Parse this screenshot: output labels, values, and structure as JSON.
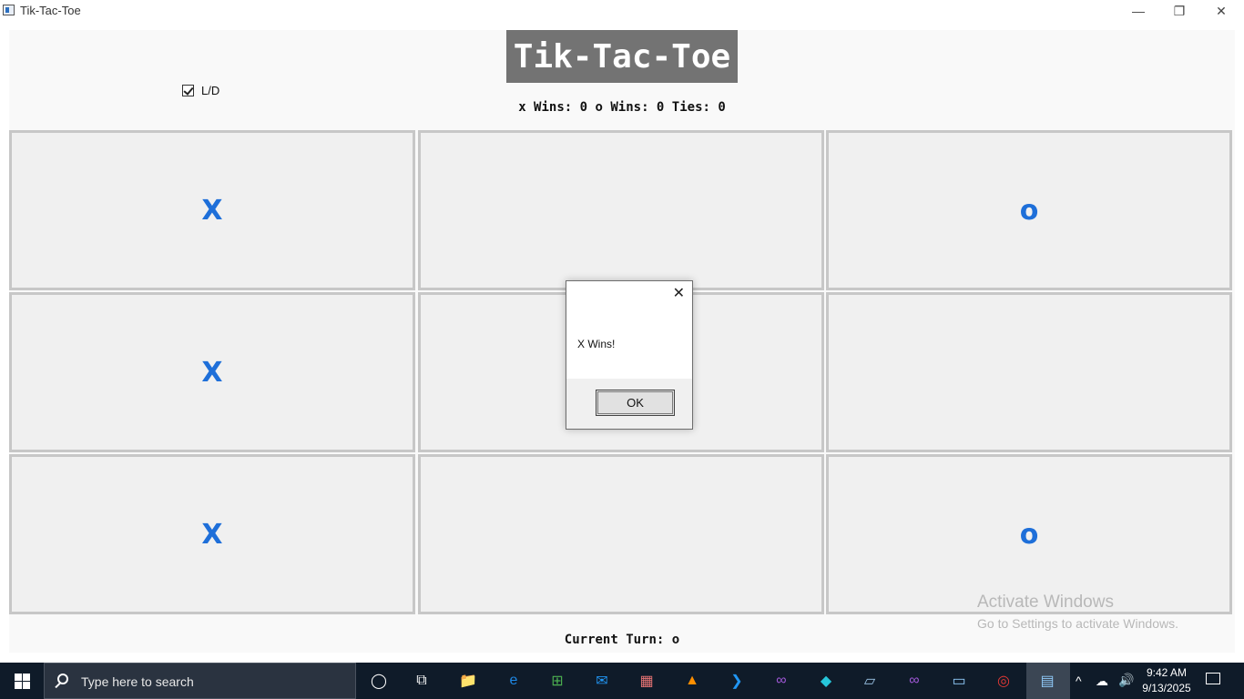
{
  "window": {
    "title": "Tik-Tac-Toe",
    "min_glyph": "—",
    "max_glyph": "❐",
    "close_glyph": "✕"
  },
  "game": {
    "title": "Tik-Tac-Toe",
    "ld_toggle": {
      "label": "L/D",
      "checked": true
    },
    "score": "x Wins: 0 o Wins: 0 Ties: 0",
    "board": [
      "X",
      "",
      "o",
      "X",
      "",
      "",
      "X",
      "",
      "o"
    ],
    "current_turn": "Current Turn: o",
    "mark_color": "#1e6fd9"
  },
  "dialog": {
    "message": "X Wins!",
    "ok_label": "OK",
    "close_glyph": "✕"
  },
  "watermark": {
    "title": "Activate Windows",
    "subtitle": "Go to Settings to activate Windows."
  },
  "taskbar": {
    "search_placeholder": "Type here to search",
    "apps": [
      {
        "name": "cortana-icon",
        "glyph": "◯"
      },
      {
        "name": "task-view-icon",
        "glyph": "⧉"
      },
      {
        "name": "file-explorer-icon",
        "glyph": "📁"
      },
      {
        "name": "edge-icon",
        "glyph": "e"
      },
      {
        "name": "store-icon",
        "glyph": "⊞"
      },
      {
        "name": "mail-icon",
        "glyph": "✉"
      },
      {
        "name": "game-app-icon",
        "glyph": "▦"
      },
      {
        "name": "vlc-icon",
        "glyph": "▲"
      },
      {
        "name": "vscode-icon",
        "glyph": "❯"
      },
      {
        "name": "visual-studio-icon",
        "glyph": "∞"
      },
      {
        "name": "app-icon-teal",
        "glyph": "◆"
      },
      {
        "name": "app-icon-paper",
        "glyph": "▱"
      },
      {
        "name": "visual-studio-preview-icon",
        "glyph": "∞"
      },
      {
        "name": "window-app-icon",
        "glyph": "▭"
      },
      {
        "name": "chrome-icon",
        "glyph": "◎"
      },
      {
        "name": "tiktactoe-taskbar-icon",
        "glyph": "▤"
      }
    ],
    "tray": {
      "chevron": "^",
      "cloud": "☁",
      "volume": "🔊"
    },
    "clock": {
      "time": "9:42 AM",
      "date": "9/13/2025"
    }
  }
}
